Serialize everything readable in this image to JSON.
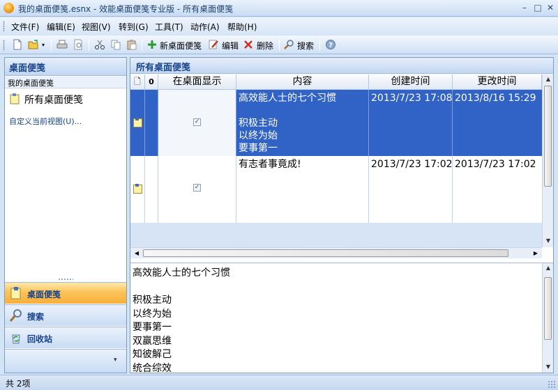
{
  "window": {
    "title": "我的桌面便笺.esnx - 效能桌面便笺专业版 - 所有桌面便笺",
    "minimize": "–",
    "maximize": "□",
    "close": "✕"
  },
  "menu": [
    "文件(F)",
    "编辑(E)",
    "视图(V)",
    "转到(G)",
    "工具(T)",
    "动作(A)",
    "帮助(H)"
  ],
  "toolbar": {
    "new_note": "新桌面便笺",
    "edit": "编辑",
    "delete": "删除",
    "search": "搜索"
  },
  "sidebar": {
    "title": "桌面便笺",
    "section": "我的桌面便笺",
    "item": "所有桌面便笺",
    "custom_view": "自定义当前视图(U)...",
    "nav": [
      {
        "label": "桌面便笺",
        "icon": "notes-icon",
        "active": true
      },
      {
        "label": "搜索",
        "icon": "search-icon",
        "active": false
      },
      {
        "label": "回收站",
        "icon": "recycle-bin-icon",
        "active": false
      }
    ]
  },
  "main": {
    "title": "所有桌面便笺",
    "columns": {
      "flag": "🗋",
      "attach": "0",
      "show_on_desktop": "在桌面显示",
      "content": "内容",
      "created": "创建时间",
      "modified": "更改时间"
    },
    "rows": [
      {
        "content": "高效能人士的七个习惯\n\n积极主动\n以终为始\n要事第一",
        "show_on_desktop": true,
        "created": "2013/7/23 17:08",
        "modified": "2013/8/16 15:29",
        "selected": true
      },
      {
        "content": "有志者事竟成!",
        "show_on_desktop": true,
        "created": "2013/7/23 17:02",
        "modified": "2013/7/23 17:02",
        "selected": false
      }
    ],
    "preview": "高效能人士的七个习惯\n\n积极主动\n以终为始\n要事第一\n双赢思维\n知彼解己\n统合综效"
  },
  "status": "共 2项",
  "colors": {
    "selection": "#3163c6",
    "header_text": "#15428b",
    "active_nav": "#fbc35a"
  }
}
